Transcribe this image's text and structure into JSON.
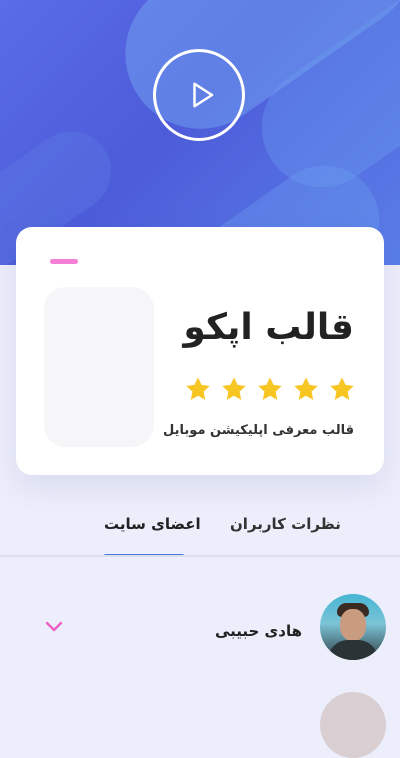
{
  "hero": {
    "play_icon": "play-icon"
  },
  "card": {
    "title": "قالب اپکو",
    "rating": 5,
    "rating_max": 5,
    "subtitle": "قالب معرفی اپلیکیشن موبایل",
    "star_color": "#f7c623",
    "accent_color": "#f57fd6"
  },
  "tabs": {
    "items": [
      {
        "label": "نظرات کاربران",
        "active": false
      },
      {
        "label": "اعضای سایت",
        "active": true
      }
    ],
    "active_color": "#4a7be0"
  },
  "members": [
    {
      "name": "هادی حبیبی",
      "expand_icon": "chevron-down-icon"
    }
  ]
}
